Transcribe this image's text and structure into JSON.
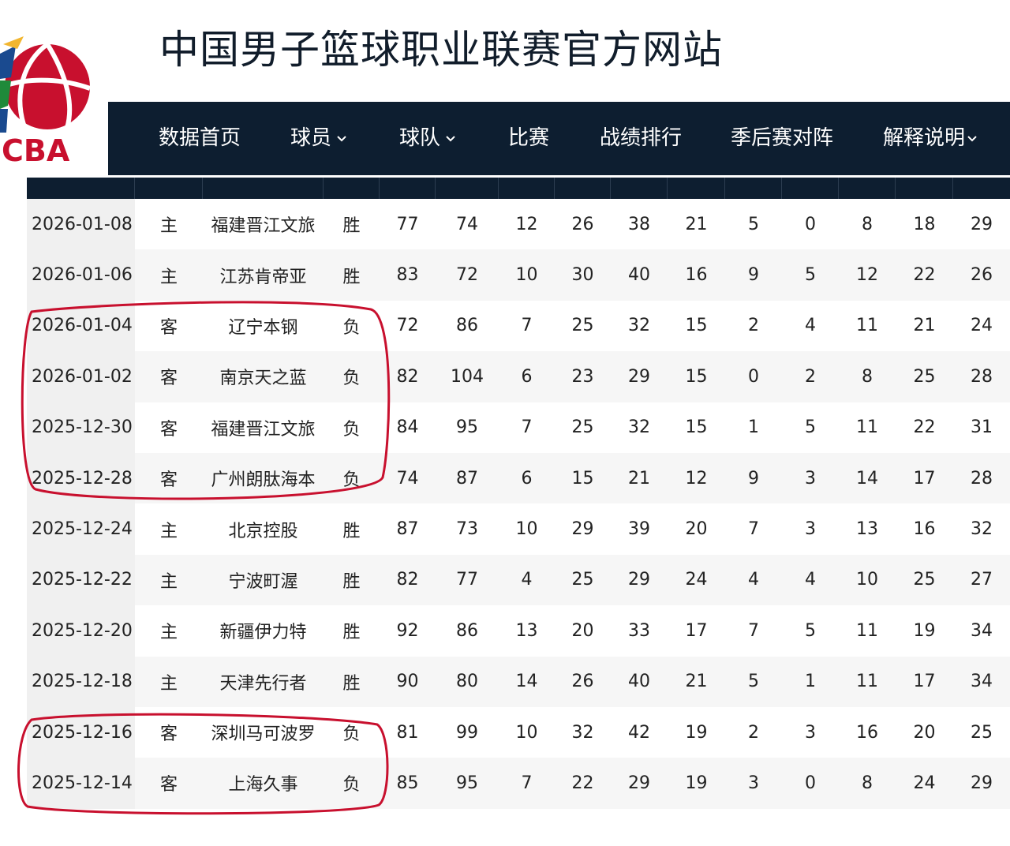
{
  "header": {
    "title": "中国男子篮球职业联赛官方网站",
    "logo_text": "CBA"
  },
  "nav": {
    "items": [
      {
        "label": "数据首页",
        "dropdown": false
      },
      {
        "label": "球员",
        "dropdown": true
      },
      {
        "label": "球队",
        "dropdown": true
      },
      {
        "label": "比赛",
        "dropdown": false
      },
      {
        "label": "战绩排行",
        "dropdown": false
      },
      {
        "label": "季后赛对阵",
        "dropdown": false
      },
      {
        "label": "解释说明",
        "dropdown": true
      }
    ]
  },
  "colors": {
    "navbar_bg": "#0d1e30",
    "annotation_red": "#c8102e",
    "text": "#222222"
  },
  "games": {
    "rows": [
      [
        "2026-01-08",
        "主",
        "福建晋江文旅",
        "胜",
        "77",
        "74",
        "12",
        "26",
        "38",
        "21",
        "5",
        "0",
        "8",
        "18",
        "29"
      ],
      [
        "2026-01-06",
        "主",
        "江苏肯帝亚",
        "胜",
        "83",
        "72",
        "10",
        "30",
        "40",
        "16",
        "9",
        "5",
        "12",
        "22",
        "26"
      ],
      [
        "2026-01-04",
        "客",
        "辽宁本钢",
        "负",
        "72",
        "86",
        "7",
        "25",
        "32",
        "15",
        "2",
        "4",
        "11",
        "21",
        "24"
      ],
      [
        "2026-01-02",
        "客",
        "南京天之蓝",
        "负",
        "82",
        "104",
        "6",
        "23",
        "29",
        "15",
        "0",
        "2",
        "8",
        "25",
        "28"
      ],
      [
        "2025-12-30",
        "客",
        "福建晋江文旅",
        "负",
        "84",
        "95",
        "7",
        "25",
        "32",
        "15",
        "1",
        "5",
        "11",
        "22",
        "31"
      ],
      [
        "2025-12-28",
        "客",
        "广州朗肽海本",
        "负",
        "74",
        "87",
        "6",
        "15",
        "21",
        "12",
        "9",
        "3",
        "14",
        "17",
        "28"
      ],
      [
        "2025-12-24",
        "主",
        "北京控股",
        "胜",
        "87",
        "73",
        "10",
        "29",
        "39",
        "20",
        "7",
        "3",
        "13",
        "16",
        "32"
      ],
      [
        "2025-12-22",
        "主",
        "宁波町渥",
        "胜",
        "82",
        "77",
        "4",
        "25",
        "29",
        "24",
        "4",
        "4",
        "10",
        "25",
        "27"
      ],
      [
        "2025-12-20",
        "主",
        "新疆伊力特",
        "胜",
        "92",
        "86",
        "13",
        "20",
        "33",
        "17",
        "7",
        "5",
        "11",
        "19",
        "34"
      ],
      [
        "2025-12-18",
        "主",
        "天津先行者",
        "胜",
        "90",
        "80",
        "14",
        "26",
        "40",
        "21",
        "5",
        "1",
        "11",
        "17",
        "34"
      ],
      [
        "2025-12-16",
        "客",
        "深圳马可波罗",
        "负",
        "81",
        "99",
        "10",
        "32",
        "42",
        "19",
        "2",
        "3",
        "16",
        "20",
        "25"
      ],
      [
        "2025-12-14",
        "客",
        "上海久事",
        "负",
        "85",
        "95",
        "7",
        "22",
        "29",
        "19",
        "3",
        "0",
        "8",
        "24",
        "29"
      ]
    ]
  }
}
